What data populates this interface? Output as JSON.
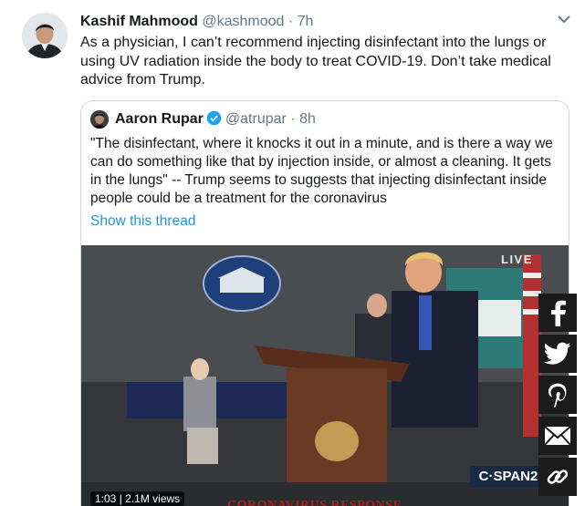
{
  "tweet": {
    "author_name": "Kashif Mahmood",
    "author_handle": "@kashmood",
    "separator": " · ",
    "time": "7h",
    "text": "As a physician, I can’t recommend injecting disinfectant into the lungs or using UV radiation inside the body to treat COVID-19. Don’t take medical advice from Trump."
  },
  "quoted": {
    "author_name": "Aaron Rupar",
    "author_handle": "@atrupar",
    "separator": " · ",
    "time": "8h",
    "text": "\"The disinfectant, where it knocks it out in a minute, and is there a way we can do something like that by injection inside, or almost a cleaning. It gets in the lungs\" -- Trump seems to suggests that injecting disinfectant inside people could be a treatment for the coronavirus",
    "show_thread": "Show this thread"
  },
  "video": {
    "live_label": "LIVE",
    "network_logo": "C·SPAN2",
    "banner": "CORONAVIRUS RESPONSE",
    "duration": "1:03 | 2.1M views"
  },
  "share": [
    "facebook",
    "twitter",
    "pinterest",
    "email",
    "link"
  ],
  "colors": {
    "link": "#1b95e0",
    "muted": "#657786",
    "border": "#ccd6dd"
  }
}
